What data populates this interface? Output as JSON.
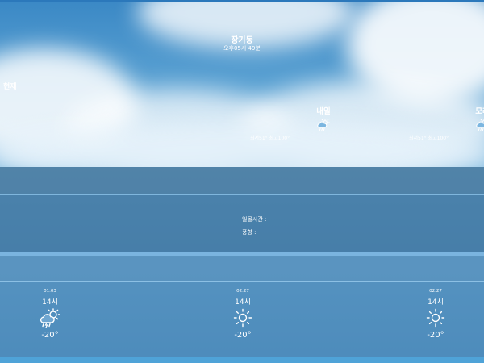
{
  "header": {
    "location": "장기동",
    "time": "오후05시 49분",
    "today_label": "현재"
  },
  "forecast": [
    {
      "label": "내일",
      "icon": "cloud-rain-sun-icon",
      "range": "최저51° 최고100°"
    },
    {
      "label": "모레",
      "icon": "cloud-rain-sun-icon",
      "range": "최저51° 최고100°"
    }
  ],
  "details": {
    "sunset": "일몰시간 :",
    "wind": "풍향 :"
  },
  "hourly": [
    {
      "date": "01.03",
      "hour": "14시",
      "icon": "thunderstorm-icon",
      "temp": "-20°"
    },
    {
      "date": "02.27",
      "hour": "14시",
      "icon": "sun-icon",
      "temp": "-20°"
    },
    {
      "date": "02.27",
      "hour": "14시",
      "icon": "sun-icon",
      "temp": "-20°"
    }
  ],
  "colors": {
    "sky_top": "#3a88c5",
    "band": "#4a7aa0",
    "separator": "#7fb6dd"
  }
}
